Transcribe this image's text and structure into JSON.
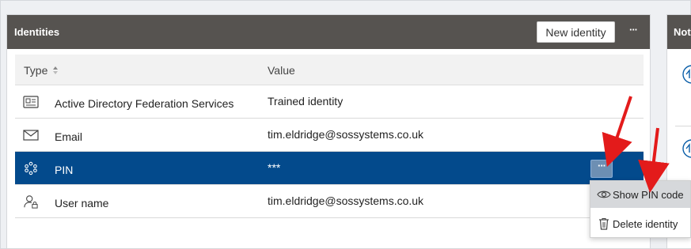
{
  "panel": {
    "title": "Identities",
    "new_button": "New identity",
    "more_button": "···"
  },
  "table": {
    "columns": {
      "type": "Type",
      "value": "Value"
    },
    "rows": [
      {
        "type": "Active Directory Federation Services",
        "value": "Trained identity",
        "icon": "id-card-icon"
      },
      {
        "type": "Email",
        "value": "tim.eldridge@sossystems.co.uk",
        "icon": "envelope-icon"
      },
      {
        "type": "PIN",
        "value": "***",
        "icon": "pin-keypad-icon",
        "selected": true
      },
      {
        "type": "User name",
        "value": "tim.eldridge@sossystems.co.uk",
        "icon": "user-lock-icon"
      }
    ],
    "row_actions_label": "···"
  },
  "side_panel": {
    "title": "Not"
  },
  "context_menu": {
    "items": [
      {
        "label": "Show PIN code",
        "icon": "eye-icon"
      },
      {
        "label": "Delete identity",
        "icon": "trash-icon"
      }
    ]
  },
  "colors": {
    "header": "#565350",
    "selected_row": "#034a8c",
    "annotation_arrow": "#e31b1b"
  }
}
